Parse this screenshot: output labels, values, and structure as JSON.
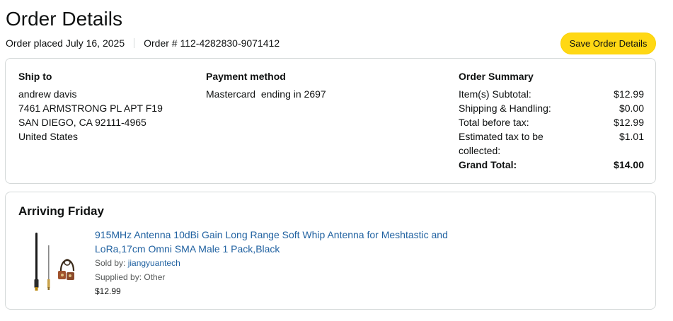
{
  "page": {
    "title": "Order Details",
    "order_placed": "Order placed July 16, 2025",
    "order_number": "Order # 112-4282830-9071412",
    "save_button": "Save Order Details"
  },
  "ship_to": {
    "heading": "Ship to",
    "name": "andrew davis",
    "address_line1": "7461 ARMSTRONG PL APT F19",
    "address_line2": "SAN DIEGO, CA 92111-4965",
    "country": "United States"
  },
  "payment": {
    "heading": "Payment method",
    "card_brand": "Mastercard",
    "ending": "ending in 2697"
  },
  "summary": {
    "heading": "Order Summary",
    "rows": [
      {
        "label": "Item(s) Subtotal:",
        "value": "$12.99"
      },
      {
        "label": "Shipping & Handling:",
        "value": "$0.00"
      },
      {
        "label": "Total before tax:",
        "value": "$12.99"
      },
      {
        "label": "Estimated tax to be collected:",
        "value": "$1.01"
      },
      {
        "label": "Grand Total:",
        "value": "$14.00"
      }
    ]
  },
  "shipment": {
    "heading": "Arriving Friday",
    "item": {
      "title": "915MHz Antenna 10dBi Gain Long Range Soft Whip Antenna for Meshtastic and LoRa,17cm Omni SMA Male 1 Pack,Black",
      "sold_by_label": "Sold by: ",
      "seller": "jiangyuantech",
      "supplied_by": "Supplied by: Other",
      "price": "$12.99"
    }
  },
  "colors": {
    "button": "#ffd814",
    "link": "#2162a1",
    "border": "#d5d9d9",
    "text": "#0f1111",
    "muted": "#565959"
  }
}
